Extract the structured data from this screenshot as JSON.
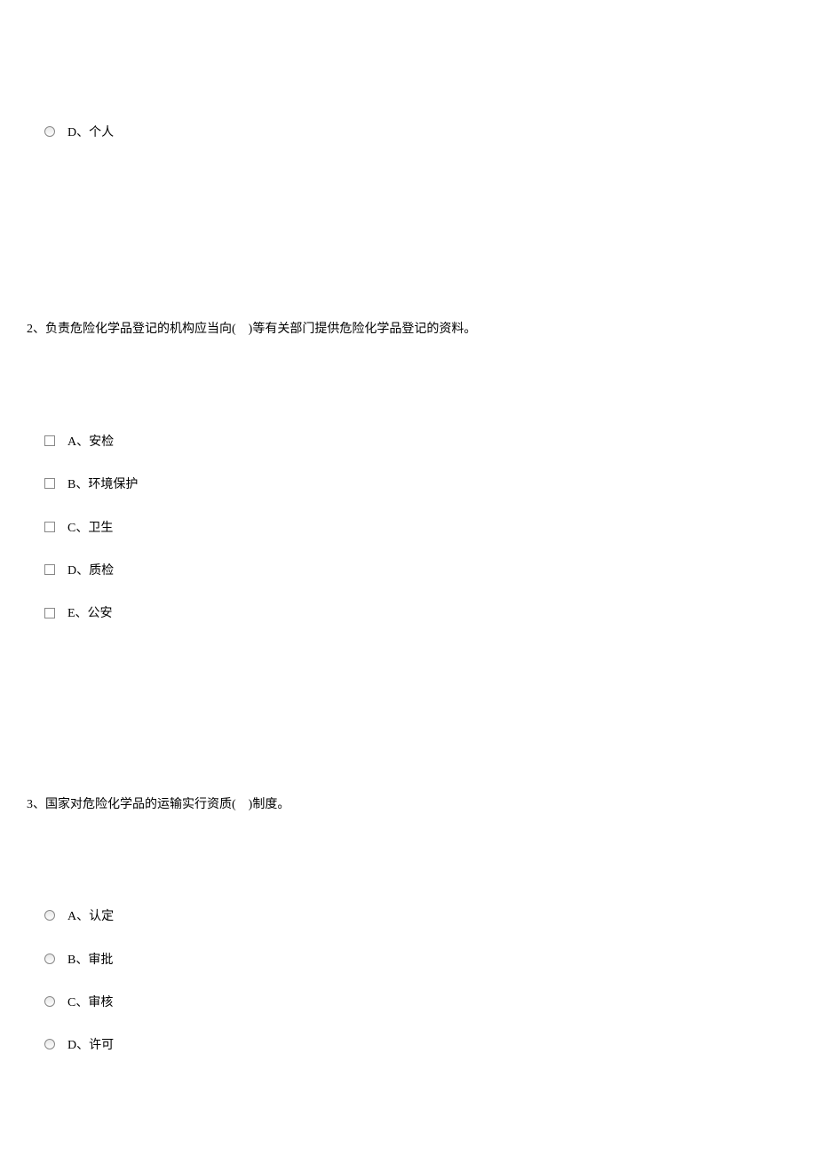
{
  "q1": {
    "options": {
      "d": "D、个人"
    }
  },
  "q2": {
    "text": "2、负责危险化学品登记的机构应当向(　)等有关部门提供危险化学品登记的资料。",
    "options": {
      "a": "A、安检",
      "b": "B、环境保护",
      "c": "C、卫生",
      "d": "D、质检",
      "e": "E、公安"
    }
  },
  "q3": {
    "text": "3、国家对危险化学品的运输实行资质(　)制度。",
    "options": {
      "a": "A、认定",
      "b": "B、审批",
      "c": "C、审核",
      "d": "D、许可"
    }
  }
}
